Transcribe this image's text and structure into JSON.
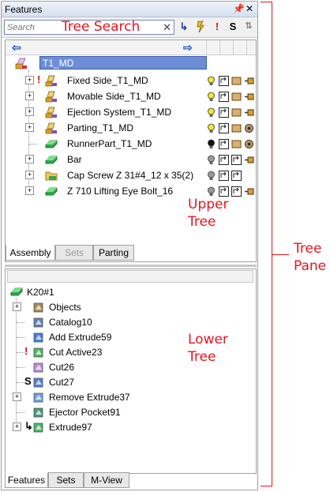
{
  "window": {
    "title": "Features",
    "pin_glyph": "↑",
    "close_glyph": "✕"
  },
  "search": {
    "placeholder": "Search",
    "value": "",
    "clear_glyph": "✕"
  },
  "search_tools": [
    {
      "name": "rollback-filter-button",
      "glyph": "↳",
      "color": "#1a3fb0"
    },
    {
      "name": "warning-filter-button",
      "glyph": "!",
      "color": "#d01010"
    },
    {
      "name": "suppressed-filter-button",
      "glyph": "S",
      "color": "#000000"
    },
    {
      "name": "sort-button",
      "glyph": "⇅",
      "color": "#888888"
    }
  ],
  "upper_tree": {
    "root_label": "T1_MD",
    "items": [
      {
        "label": "Fixed Side_T1_MD",
        "prefix": "!",
        "icon": "assembly-icon",
        "bulb": "on"
      },
      {
        "label": "Movable Side_T1_MD",
        "prefix": "",
        "icon": "assembly-icon",
        "bulb": "on"
      },
      {
        "label": "Ejection System_T1_MD",
        "prefix": "",
        "icon": "assembly-icon",
        "bulb": "on"
      },
      {
        "label": "Parting_T1_MD",
        "prefix": "",
        "icon": "assembly-icon",
        "bulb": "on"
      },
      {
        "label": "RunnerPart_T1_MD",
        "prefix": "",
        "icon": "part-icon",
        "bulb": "off"
      },
      {
        "label": "Bar",
        "prefix": "",
        "icon": "part-icon",
        "bulb": "dim"
      },
      {
        "label": "Cap Screw Z 31#4_12 x 35(2)",
        "prefix": "",
        "icon": "folder-icon",
        "bulb": "dim"
      },
      {
        "label": "Z 710 Lifting Eye Bolt_16",
        "prefix": "",
        "icon": "part-icon",
        "bulb": "dim"
      }
    ],
    "tabs": [
      {
        "label": "Assembly",
        "state": "active"
      },
      {
        "label": "Sets",
        "state": "disabled"
      },
      {
        "label": "Parting",
        "state": "normal"
      }
    ]
  },
  "lower_tree": {
    "root_label": "K20#1",
    "items": [
      {
        "label": "Objects",
        "prefix": "",
        "expandable": true
      },
      {
        "label": "Catalog10",
        "prefix": "",
        "expandable": false
      },
      {
        "label": "Add Extrude59",
        "prefix": "",
        "expandable": false
      },
      {
        "label": "Cut Active23",
        "prefix": "!",
        "expandable": false
      },
      {
        "label": "Cut26",
        "prefix": "",
        "expandable": false
      },
      {
        "label": "Cut27",
        "prefix": "S",
        "expandable": false
      },
      {
        "label": "Remove Extrude37",
        "prefix": "",
        "expandable": true
      },
      {
        "label": "Ejector Pocket91",
        "prefix": "",
        "expandable": false
      },
      {
        "label": "Extrude97",
        "prefix": "↳",
        "expandable": true
      }
    ],
    "tabs": [
      {
        "label": "Features",
        "state": "active"
      },
      {
        "label": "Sets",
        "state": "normal"
      },
      {
        "label": "M-View",
        "state": "normal"
      }
    ]
  },
  "annotations": {
    "tree_search": "Tree Search",
    "upper_tree_l1": "Upper",
    "upper_tree_l2": "Tree",
    "lower_tree_l1": "Lower",
    "lower_tree_l2": "Tree",
    "tree_pane_l1": "Tree",
    "tree_pane_l2": "Pane",
    "color": "#e8141e"
  },
  "colors": {
    "selection": "#6d8ed6",
    "nav_arrow": "#1e56c8",
    "bulb_on": "#f5e62a",
    "bulb_off": "#111111",
    "bulb_dim": "#9a9a9a"
  }
}
